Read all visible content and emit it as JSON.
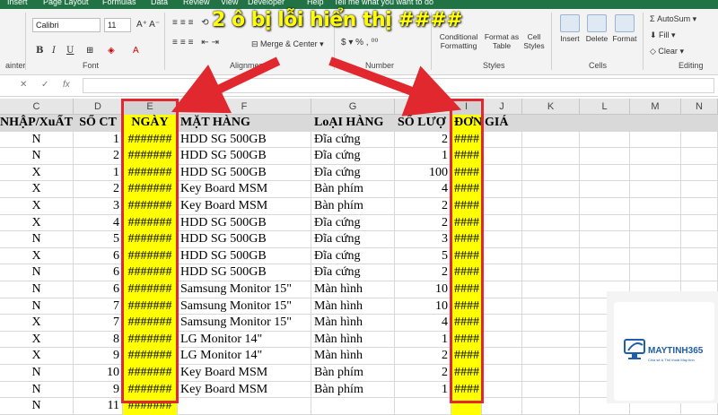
{
  "ribbon": {
    "tabs": [
      "Insert",
      "Page Layout",
      "Formulas",
      "Data",
      "Review",
      "View",
      "Developer",
      "Help",
      "Tell me what you want to do"
    ],
    "font_name": "Calibri",
    "font_size": "11",
    "merge_center": "Merge & Center",
    "conditional": "Conditional Formatting",
    "format_table": "Format as Table",
    "cell_styles": "Cell Styles",
    "insert": "Insert",
    "delete": "Delete",
    "format": "Format",
    "autosum": "AutoSum",
    "fill": "Fill",
    "clear": "Clear",
    "groups": {
      "clipboard": "ainter",
      "font": "Font",
      "alignment": "Alignment",
      "number": "Number",
      "styles": "Styles",
      "cells": "Cells",
      "editing": "Editing"
    },
    "format_buttons": {
      "bold": "B",
      "italic": "I",
      "underline": "U"
    }
  },
  "formula_bar": {
    "cancel": "✕",
    "enter": "✓",
    "fx": "fx"
  },
  "annotation": {
    "title": "2 ô bị lỗi hiển thị ####",
    "color": "#ffff00",
    "arrow_color": "#e0282e"
  },
  "columns": [
    "C",
    "D",
    "E",
    "F",
    "G",
    "H",
    "I",
    "J",
    "K",
    "L",
    "M",
    "N"
  ],
  "header_row": [
    "NHẬP/XuẤT",
    "SỐ CT",
    "NGÀY",
    "MẶT HÀNG",
    "LoẠI HÀNG",
    "SỐ LƯỢ",
    "ĐƠN",
    "GIÁ"
  ],
  "rows": [
    [
      "N",
      "1",
      "#######",
      "HDD SG 500GB",
      "Đĩa cứng",
      "2",
      "####"
    ],
    [
      "N",
      "2",
      "#######",
      "HDD SG 500GB",
      "Đĩa cứng",
      "1",
      "####"
    ],
    [
      "X",
      "1",
      "#######",
      "HDD SG 500GB",
      "Đĩa cứng",
      "100",
      "####"
    ],
    [
      "X",
      "2",
      "#######",
      "Key Board MSM",
      "Bàn phím",
      "4",
      "####"
    ],
    [
      "X",
      "3",
      "#######",
      "Key Board MSM",
      "Bàn phím",
      "2",
      "####"
    ],
    [
      "X",
      "4",
      "#######",
      "HDD SG 500GB",
      "Đĩa cứng",
      "2",
      "####"
    ],
    [
      "N",
      "5",
      "#######",
      "HDD SG 500GB",
      "Đĩa cứng",
      "3",
      "####"
    ],
    [
      "X",
      "6",
      "#######",
      "HDD SG 500GB",
      "Đĩa cứng",
      "5",
      "####"
    ],
    [
      "N",
      "6",
      "#######",
      "HDD SG 500GB",
      "Đĩa cứng",
      "2",
      "####"
    ],
    [
      "N",
      "6",
      "#######",
      "Samsung Monitor 15\"",
      "Màn hình",
      "10",
      "####"
    ],
    [
      "N",
      "7",
      "#######",
      "Samsung Monitor 15\"",
      "Màn hình",
      "10",
      "####"
    ],
    [
      "X",
      "7",
      "#######",
      "Samsung Monitor 15\"",
      "Màn hình",
      "4",
      "####"
    ],
    [
      "X",
      "8",
      "#######",
      "LG Monitor 14\"",
      "Màn hình",
      "1",
      "####"
    ],
    [
      "X",
      "9",
      "#######",
      "LG Monitor 14\"",
      "Màn hình",
      "2",
      "####"
    ],
    [
      "N",
      "10",
      "#######",
      "Key Board MSM",
      "Bàn phím",
      "2",
      "####"
    ],
    [
      "N",
      "9",
      "#######",
      "Key Board MSM",
      "Bàn phím",
      "1",
      "####"
    ],
    [
      "N",
      "11",
      "#######",
      "",
      "",
      "",
      ""
    ]
  ],
  "logo": {
    "name": "MAYTINH365",
    "tagline": "Chia sẻ & Thủ thuật Máy tính"
  }
}
